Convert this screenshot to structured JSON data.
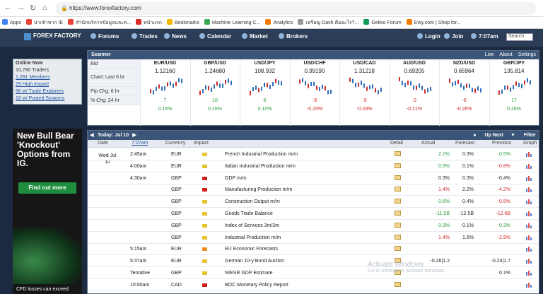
{
  "browser": {
    "url": "https://www.forexfactory.com"
  },
  "bookmarks": [
    "Apps",
    "น่าเข้าหาก IE",
    "สำนักบริการข้อมูลและส...",
    "หน้าแรก",
    "Bookmarks",
    "Machine Learning C...",
    "Analytics",
    "เหรียญ Dash คืออะไร?...",
    "Gekko Forum",
    "Etsy.com | Shop for..."
  ],
  "site": {
    "logo": "FOREX FACTORY",
    "nav": [
      "Forums",
      "Trades",
      "News",
      "Calendar",
      "Market",
      "Brokers"
    ],
    "right": {
      "login": "Login",
      "join": "Join",
      "time": "7:07am",
      "search_placeholder": "Search"
    }
  },
  "online": {
    "title": "Online Now",
    "items": [
      "10,780 Traders",
      "1,091 Members",
      "29 High Impact",
      "96 w/ Trade Explorers",
      "16 w/ Posted Systems"
    ]
  },
  "ad": {
    "headline": "New Bull Bear 'Knockout' Options from IG.",
    "cta": "Find out more",
    "disclaimer": "CFD losses can exceed"
  },
  "scanner": {
    "title": "Scanner",
    "buttons": [
      "Live",
      "About",
      "Settings"
    ],
    "row_labels": [
      "Bid",
      "Chart: Last 6 hr",
      "Pip Chg: 6 hr",
      "% Chg: 24 hr"
    ],
    "pairs": [
      {
        "name": "EUR/USD",
        "bid": "1.12160",
        "pip": "7",
        "pct": "0.14%",
        "dir": "up"
      },
      {
        "name": "GBP/USD",
        "bid": "1.24680",
        "pip": "10",
        "pct": "0.16%",
        "dir": "up"
      },
      {
        "name": "USD/JPY",
        "bid": "108.932",
        "pip": "6",
        "pct": "0.10%",
        "dir": "up"
      },
      {
        "name": "USD/CHF",
        "bid": "0.99190",
        "pip": "-9",
        "pct": "-0.25%",
        "dir": "down"
      },
      {
        "name": "USD/CAD",
        "bid": "1.31218",
        "pip": "-9",
        "pct": "-0.03%",
        "dir": "down"
      },
      {
        "name": "AUD/USD",
        "bid": "0.69205",
        "pip": "-2",
        "pct": "-0.21%",
        "dir": "down"
      },
      {
        "name": "NZD/USD",
        "bid": "0.65964",
        "pip": "-6",
        "pct": "-0.26%",
        "dir": "down"
      },
      {
        "name": "GBP/JPY",
        "bid": "135.814",
        "pip": "17",
        "pct": "0.26%",
        "dir": "up"
      }
    ]
  },
  "calendar": {
    "today_label": "Today: Jul 10",
    "up_next": "Up Next",
    "filter": "Filter",
    "columns": [
      "Date",
      "7:07am",
      "Currency",
      "Impact",
      "Detail",
      "Actual",
      "Forecast",
      "Previous",
      "Graph"
    ],
    "date": "Wed Jul 10",
    "events": [
      {
        "time": "2:45am",
        "cur": "EUR",
        "impact": "yellow",
        "name": "French Industrial Production m/m",
        "actual": "2.1%",
        "actual_dir": "up",
        "forecast": "0.3%",
        "previous": "0.5%",
        "prev_dir": "up"
      },
      {
        "time": "4:00am",
        "cur": "EUR",
        "impact": "yellow",
        "name": "Italian Industrial Production m/m",
        "actual": "0.9%",
        "actual_dir": "up",
        "forecast": "0.1%",
        "previous": "-0.8%",
        "prev_dir": "down"
      },
      {
        "time": "4:30am",
        "cur": "GBP",
        "impact": "red",
        "name": "GDP m/m",
        "actual": "0.3%",
        "actual_dir": "",
        "forecast": "0.3%",
        "previous": "-0.4%",
        "prev_dir": ""
      },
      {
        "time": "",
        "cur": "GBP",
        "impact": "red",
        "name": "Manufacturing Production m/m",
        "actual": "1.4%",
        "actual_dir": "down",
        "forecast": "2.2%",
        "previous": "-4.2%",
        "prev_dir": "down"
      },
      {
        "time": "",
        "cur": "GBP",
        "impact": "yellow",
        "name": "Construction Output m/m",
        "actual": "0.6%",
        "actual_dir": "up",
        "forecast": "0.4%",
        "previous": "-0.5%",
        "prev_dir": "down"
      },
      {
        "time": "",
        "cur": "GBP",
        "impact": "yellow",
        "name": "Goods Trade Balance",
        "actual": "-11.5B",
        "actual_dir": "up",
        "forecast": "-12.5B",
        "previous": "-12.8B",
        "prev_dir": "down"
      },
      {
        "time": "",
        "cur": "GBP",
        "impact": "yellow",
        "name": "Index of Services 3m/3m",
        "actual": "0.3%",
        "actual_dir": "up",
        "forecast": "0.1%",
        "previous": "0.3%",
        "prev_dir": "up"
      },
      {
        "time": "",
        "cur": "GBP",
        "impact": "yellow",
        "name": "Industrial Production m/m",
        "actual": "1.4%",
        "actual_dir": "down",
        "forecast": "1.6%",
        "previous": "-2.9%",
        "prev_dir": "down"
      },
      {
        "time": "5:15am",
        "cur": "EUR",
        "impact": "orange",
        "name": "EU Economic Forecasts",
        "actual": "",
        "actual_dir": "",
        "forecast": "",
        "previous": "",
        "prev_dir": ""
      },
      {
        "time": "5:37am",
        "cur": "EUR",
        "impact": "yellow",
        "name": "German 10-y Bond Auction",
        "actual": "-0.26|1.2",
        "actual_dir": "",
        "forecast": "",
        "previous": "-0.24|1.7",
        "prev_dir": ""
      },
      {
        "time": "Tentative",
        "cur": "GBP",
        "impact": "yellow",
        "name": "NIESR GDP Estimate",
        "actual": "",
        "actual_dir": "",
        "forecast": "",
        "previous": "0.1%",
        "prev_dir": ""
      },
      {
        "time": "10:00am",
        "cur": "CAD",
        "impact": "red",
        "name": "BOC Monetary Policy Report",
        "actual": "",
        "actual_dir": "",
        "forecast": "",
        "previous": "",
        "prev_dir": ""
      }
    ]
  },
  "watermark": {
    "line1": "Activate Windows",
    "line2": "Go to Settings to activate Windows."
  },
  "colors": {
    "header": "#2c3e57",
    "scanner_head": "#3b5578",
    "up": "#2a9d3a",
    "down": "#d02a2a",
    "impact_red": "#d11f1f",
    "impact_yellow": "#e6c42c",
    "impact_orange": "#f08a24"
  }
}
